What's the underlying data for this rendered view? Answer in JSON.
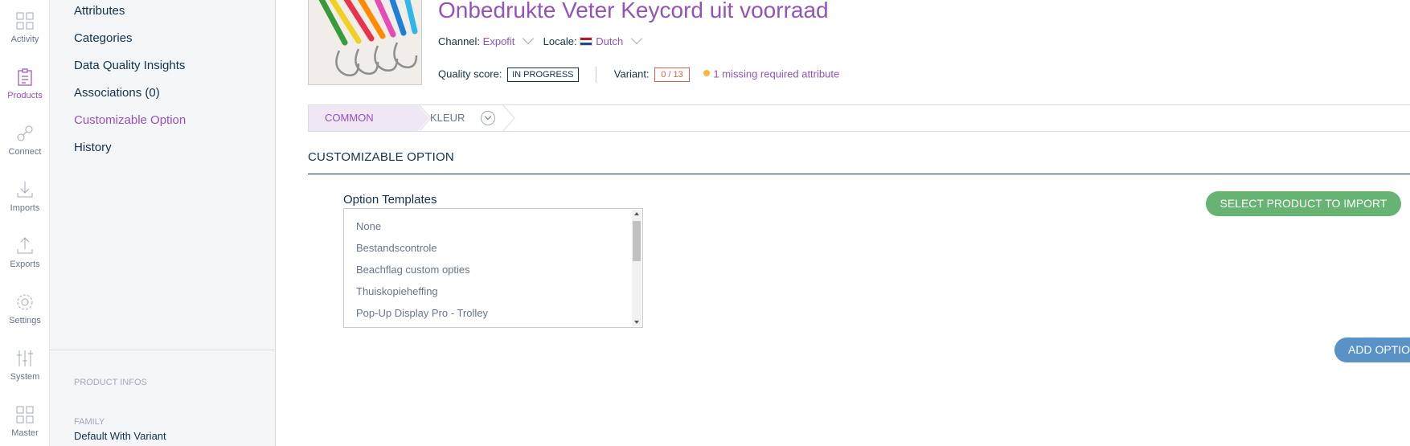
{
  "rail": {
    "items": [
      {
        "label": "Activity",
        "icon": "activity-icon"
      },
      {
        "label": "Products",
        "icon": "products-icon"
      },
      {
        "label": "Connect",
        "icon": "connect-icon"
      },
      {
        "label": "Imports",
        "icon": "imports-icon"
      },
      {
        "label": "Exports",
        "icon": "exports-icon"
      },
      {
        "label": "Settings",
        "icon": "settings-icon"
      },
      {
        "label": "System",
        "icon": "system-icon"
      },
      {
        "label": "Master",
        "icon": "master-icon"
      }
    ]
  },
  "subnav": {
    "items": [
      {
        "label": "Attributes"
      },
      {
        "label": "Categories"
      },
      {
        "label": "Data Quality Insights"
      },
      {
        "label": "Associations (0)"
      },
      {
        "label": "Customizable Option"
      },
      {
        "label": "History"
      }
    ],
    "section_heading": "PRODUCT INFOS",
    "family_label": "FAMILY",
    "family_value": "Default With Variant"
  },
  "product": {
    "title": "Onbedrukte Veter Keycord uit voorraad",
    "channel_label": "Channel:",
    "channel_value": "Expofit",
    "locale_label": "Locale:",
    "locale_value": "Dutch",
    "quality_label": "Quality score:",
    "quality_value": "IN PROGRESS",
    "variant_label": "Variant:",
    "variant_value": "0 / 13",
    "missing_text": "1 missing required attribute"
  },
  "axis": {
    "common_label": "COMMON",
    "kleur_label": "KLEUR"
  },
  "section": {
    "title": "CUSTOMIZABLE OPTION",
    "option_templates_label": "Option Templates",
    "options": [
      "None",
      "Bestandscontrole",
      "Beachflag custom opties",
      "Thuiskopieheffing",
      "Pop-Up Display Pro - Trolley"
    ],
    "select_button": "SELECT PRODUCT TO IMPORT",
    "add_button": "ADD OPTION"
  },
  "colors": {
    "accent": "#9452ba",
    "green": "#67b373",
    "blue": "#5992c7",
    "text": "#11324d"
  }
}
